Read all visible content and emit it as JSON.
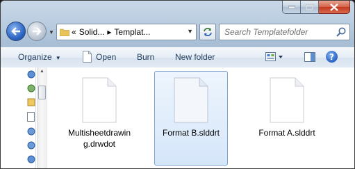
{
  "window": {
    "caption": {
      "minimize": "minimize",
      "maximize": "maximize",
      "close": "close"
    }
  },
  "address_bar": {
    "overflow": "«",
    "crumbs": [
      "Solid...",
      "Templat..."
    ],
    "separator": "▸"
  },
  "search": {
    "placeholder": "Search Templatefolder"
  },
  "toolbar": {
    "organize_label": "Organize",
    "open_label": "Open",
    "burn_label": "Burn",
    "new_folder_label": "New folder",
    "help_label": "?"
  },
  "files": [
    {
      "name": "Multisheetdrawing.drwdot",
      "selected": false
    },
    {
      "name": "Format B.slddrt",
      "selected": true
    },
    {
      "name": "Format A.slddrt",
      "selected": false
    }
  ],
  "colors": {
    "selection_fill": "#d5e6fa",
    "selection_border": "#7da2ce",
    "toolbar_text": "#1e395b",
    "close_button": "#c2391f"
  }
}
